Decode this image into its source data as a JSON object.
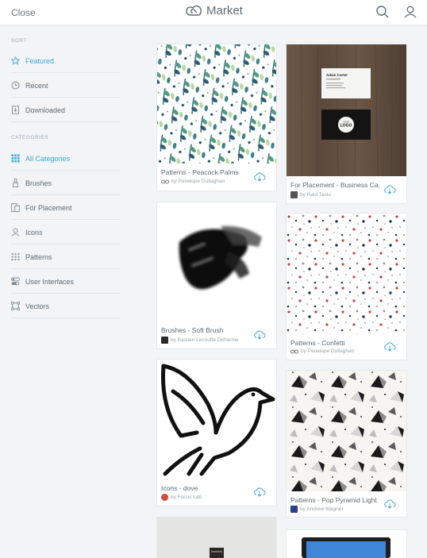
{
  "header": {
    "close_label": "Close",
    "brand_label": "Market",
    "icons": [
      "creative-cloud-logo-icon",
      "search-icon",
      "user-icon"
    ]
  },
  "sidebar": {
    "sort_title": "SORT",
    "sort_items": [
      {
        "label": "Featured",
        "icon": "star-icon",
        "active": true
      },
      {
        "label": "Recent",
        "icon": "clock-icon",
        "active": false
      },
      {
        "label": "Downloaded",
        "icon": "download-file-icon",
        "active": false
      }
    ],
    "categories_title": "CATEGORIES",
    "category_items": [
      {
        "label": "All Categories",
        "icon": "grid-icon",
        "active": true
      },
      {
        "label": "Brushes",
        "icon": "brush-icon",
        "active": false
      },
      {
        "label": "For Placement",
        "icon": "placement-icon",
        "active": false
      },
      {
        "label": "Icons",
        "icon": "person-icon",
        "active": false
      },
      {
        "label": "Patterns",
        "icon": "pattern-icon",
        "active": false
      },
      {
        "label": "User Interfaces",
        "icon": "toggle-icon",
        "active": false
      },
      {
        "label": "Vectors",
        "icon": "vector-icon",
        "active": false
      }
    ]
  },
  "cards": [
    {
      "title": "Patterns - Peacock Palms",
      "author": "by Penelope Dullaghan"
    },
    {
      "title": "For Placement - Business Ca...",
      "author": "by Raul Tasiu"
    },
    {
      "title": "Brushes - Soft Brush",
      "author": "by Bastien Lecouffe Deharme"
    },
    {
      "title": "Patterns - Confetti",
      "author": "by Penelope Dullaghan"
    },
    {
      "title": "Icons - dove",
      "author": "by Focus Lab"
    },
    {
      "title": "Patterns - Pop Pyramid Light",
      "author": "by Andrew Wagner"
    }
  ],
  "business_card": {
    "name": "Adam Carter",
    "logo_top": "YOUR",
    "logo_text": "LOGO"
  },
  "colors": {
    "accent": "#3ea6d6",
    "text": "#5f6a75",
    "muted": "#9aa3ab",
    "background": "#f2f4f5"
  }
}
